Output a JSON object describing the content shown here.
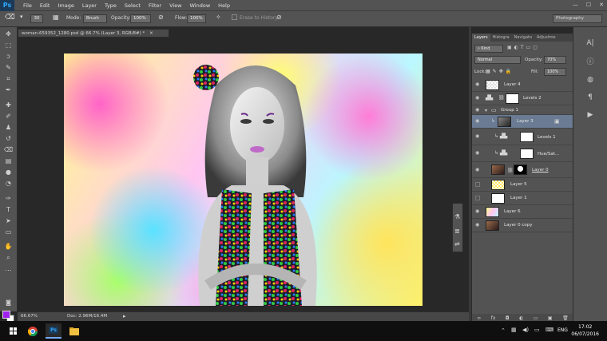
{
  "app": {
    "logo": "Ps"
  },
  "menu": [
    "File",
    "Edit",
    "Image",
    "Layer",
    "Type",
    "Select",
    "Filter",
    "View",
    "Window",
    "Help"
  ],
  "window_controls": [
    "—",
    "☐",
    "✕"
  ],
  "options": {
    "brush_size": "30",
    "mode_label": "Mode:",
    "mode_value": "Brush",
    "opacity_label": "Opacity:",
    "opacity_value": "100%",
    "flow_label": "Flow:",
    "flow_value": "100%",
    "erase_history": "Erase to History",
    "workspace": "Photography"
  },
  "document": {
    "tab_title": "woman-659352_1280.psd @ 66.7% (Layer 3, RGB/8#) *",
    "zoom": "66.67%",
    "doc_size": "Doc: 2.96M/16.4M"
  },
  "colors": {
    "foreground": "#a020f0",
    "background": "#ffffff",
    "accent_selected": "#6a7b93"
  },
  "layers_panel": {
    "tabs": [
      "Layers",
      "Histogra",
      "Navigato",
      "Adjustme"
    ],
    "kind": "Kind",
    "blend_mode": "Normal",
    "opacity_label": "Opacity:",
    "opacity_value": "70%",
    "lock_label": "Lock:",
    "fill_label": "Fill:",
    "fill_value": "100%",
    "layers": [
      {
        "name": "Layer 4"
      },
      {
        "name": "Levels 2"
      },
      {
        "name": "Group 1"
      },
      {
        "name": "Layer 3"
      },
      {
        "name": "Levels 1"
      },
      {
        "name": "Hue/Sat..."
      },
      {
        "name": "Layer 0"
      },
      {
        "name": "Layer 5"
      },
      {
        "name": "Layer 1"
      },
      {
        "name": "Layer 6"
      },
      {
        "name": "Layer 0 copy"
      }
    ],
    "footer_icons": [
      "∞",
      "fx",
      "◘",
      "◐",
      "▭",
      "▣",
      "🗑"
    ]
  },
  "taskbar": {
    "language": "ENG",
    "time": "17:02",
    "date": "06/07/2016"
  }
}
